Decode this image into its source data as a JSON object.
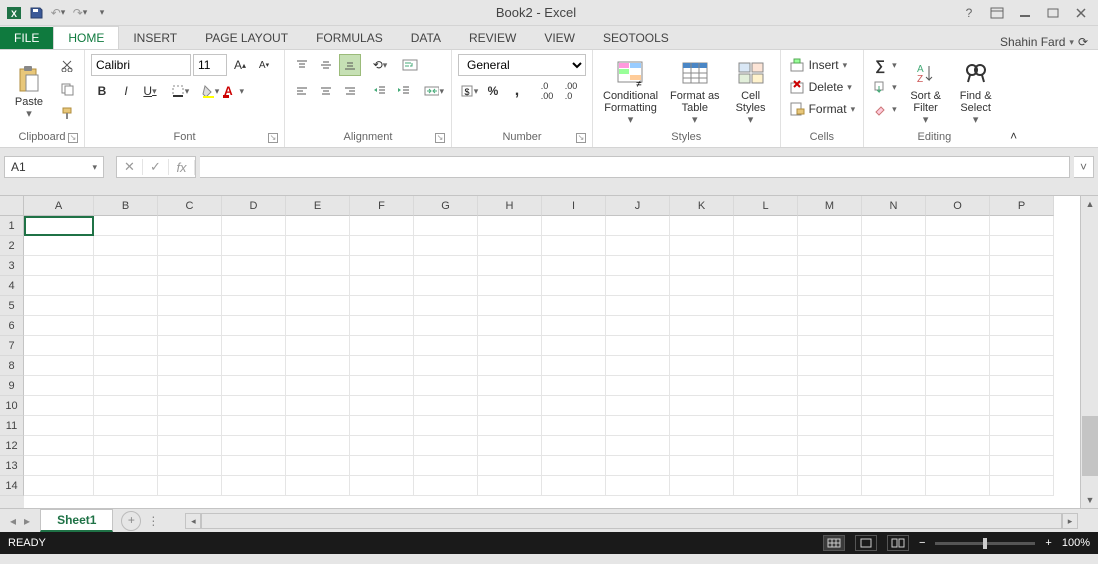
{
  "title": "Book2 - Excel",
  "user": "Shahin Fard",
  "tabs": {
    "file": "FILE",
    "home": "HOME",
    "insert": "INSERT",
    "page": "PAGE LAYOUT",
    "formulas": "FORMULAS",
    "data": "DATA",
    "review": "REVIEW",
    "view": "VIEW",
    "seo": "SEOTOOLS"
  },
  "ribbon": {
    "clipboard": {
      "label": "Clipboard",
      "paste": "Paste"
    },
    "font": {
      "label": "Font",
      "name": "Calibri",
      "size": "11"
    },
    "alignment": {
      "label": "Alignment"
    },
    "number": {
      "label": "Number",
      "format": "General"
    },
    "styles": {
      "label": "Styles",
      "cf": "Conditional\nFormatting",
      "ft": "Format as\nTable",
      "cs": "Cell\nStyles"
    },
    "cells": {
      "label": "Cells",
      "insert": "Insert",
      "delete": "Delete",
      "format": "Format"
    },
    "editing": {
      "label": "Editing",
      "sort": "Sort &\nFilter",
      "find": "Find &\nSelect"
    }
  },
  "formula": {
    "cellref": "A1"
  },
  "sheet": {
    "name": "Sheet1"
  },
  "columns": [
    "A",
    "B",
    "C",
    "D",
    "E",
    "F",
    "G",
    "H",
    "I",
    "J",
    "K",
    "L",
    "M",
    "N",
    "O",
    "P"
  ],
  "rows": [
    "1",
    "2",
    "3",
    "4",
    "5",
    "6",
    "7",
    "8",
    "9",
    "10",
    "11",
    "12",
    "13",
    "14"
  ],
  "status": {
    "ready": "READY",
    "zoom": "100%"
  }
}
